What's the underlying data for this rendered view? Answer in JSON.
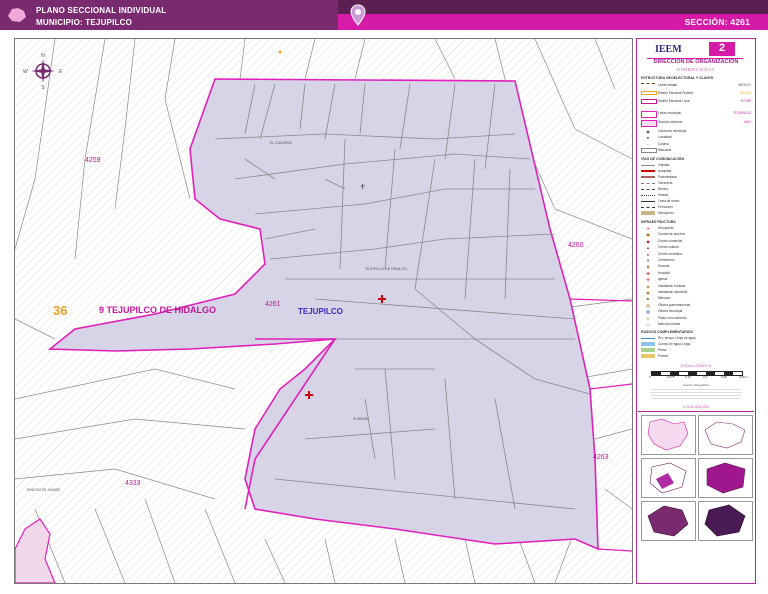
{
  "header": {
    "title": "PLANO SECCIONAL INDIVIDUAL",
    "municipio": "MUNICIPIO: TEJUPILCO",
    "seccion": "SECCIÓN: 4261"
  },
  "compass": {
    "n": "N",
    "s": "S",
    "e": "E",
    "w": "W"
  },
  "map": {
    "labels": {
      "section_main": "4261",
      "section_n_w": "4259",
      "section_e": "4260",
      "section_se": "4263",
      "section_sw": "4333",
      "district_number": "36",
      "district_name": "9 TEJUPILCO DE HIDALGO",
      "locality": "TEJUPILCO",
      "colonia_calvario": "EL CALVARIO",
      "colonia_centro": "TEJUPILCO DE HIDALGO",
      "colonia_sur": "SUSENIN",
      "rincon": "RINCON DE JAIMES"
    }
  },
  "legend": {
    "org_logo": "IEEM",
    "org_title": "DIRECCIÓN DE ORGANIZACIÓN",
    "simbologia": "SIMBOLOGÍA",
    "estructura_title": "ESTRUCTURA GEOELECTORAL Y CLAVES",
    "estructura": [
      {
        "label": "Límite estatal",
        "value": "MÉXICO"
      },
      {
        "label": "Distrito Electoral Federal",
        "value": "36 ZGA"
      },
      {
        "label": "Distrito Electoral Local",
        "value": "9 CHPI"
      },
      {
        "label": "Límite municipal",
        "value": "TEJUPILCO"
      },
      {
        "label": "Sección electoral",
        "value": "4261"
      },
      {
        "label": "Cabecera municipal",
        "value": ""
      },
      {
        "label": "Localidad",
        "value": ""
      },
      {
        "label": "Colonia",
        "value": ""
      },
      {
        "label": "Manzana",
        "value": ""
      }
    ],
    "vias_title": "VÍAS DE COMUNICACIÓN",
    "vias": [
      "Vialidad",
      "Autopista",
      "Pavimentada",
      "Terracería",
      "Brecha",
      "Vereda",
      "Línea de metro",
      "Ferrocarril",
      "Mexipuerto"
    ],
    "infra_title": "INFRAESTRUCTURA",
    "infra": [
      "Aeropuerto",
      "Central de autobús",
      "Centro comercial",
      "Centro cultural",
      "Centro recreativo",
      "Cementerio",
      "Escuela",
      "Hospital",
      "Iglesia",
      "Instalación turística",
      "Instalación deportiva",
      "Mercado",
      "Oficina gubernamental",
      "Oficina municipal",
      "Plaza o monumento",
      "Mancha urbana"
    ],
    "rasgos_title": "RASGOS COMPLEMENTARIOS",
    "rasgos": [
      "Río, arroyo o flujo de agua",
      "Cuerpo de agua o lago",
      "Presa",
      "Puente"
    ],
    "escala_title": "ESCALA GRÁFICA",
    "escala_ticks": [
      "0",
      "0.075",
      "0.15",
      "0.3",
      "0.45",
      "0.6"
    ],
    "escala_unit": "Km",
    "notas": "Fuente cartográfica",
    "ubicacion_title": "LOCALIZACIÓN"
  },
  "colors": {
    "header_dark": "#5c1f52",
    "header_mid": "#7a2a6e",
    "header_bright": "#d61aa8",
    "section_fill": "#d6d4e6",
    "boundary": "#e020b8",
    "label_magenta": "#c0189a",
    "label_orange": "#e8a21b",
    "label_blue": "#3a2acc"
  }
}
